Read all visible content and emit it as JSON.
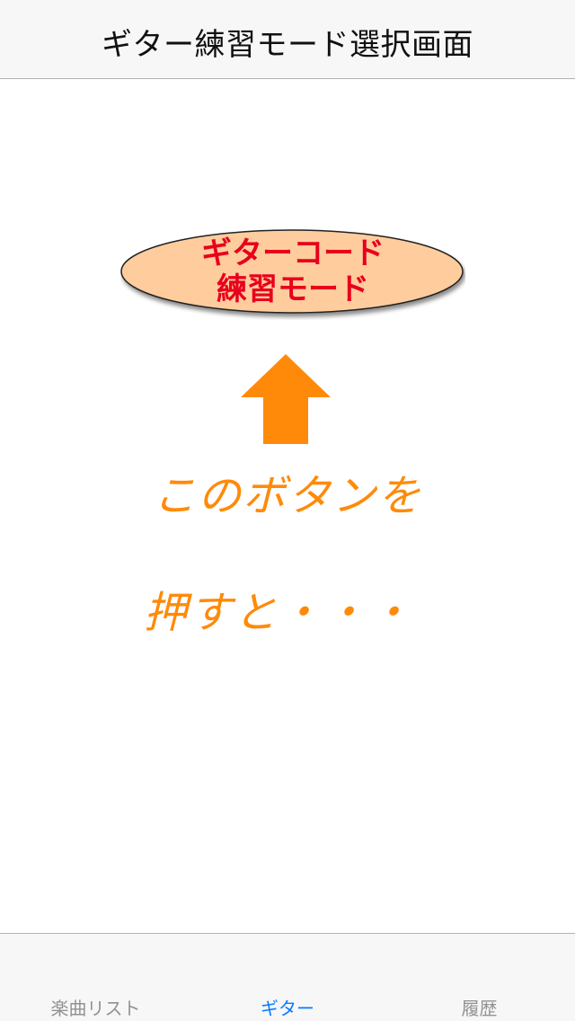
{
  "nav": {
    "title": "ギター練習モード選択画面"
  },
  "main": {
    "mode_button": {
      "line1": "ギターコード",
      "line2": "練習モード"
    },
    "hint": {
      "line1": "このボタンを",
      "line2": "押すと・・・"
    }
  },
  "tabs": [
    {
      "label": "楽曲リスト",
      "selected": false
    },
    {
      "label": "ギター",
      "selected": true
    },
    {
      "label": "履歴",
      "selected": false
    }
  ],
  "colors": {
    "accent": "#0a7aff",
    "tab_inactive": "#929292",
    "button_fill": "#ffcc9e",
    "button_text": "#e8001c",
    "hint_text": "#ff8a0a",
    "arrow": "#ff8a0a"
  },
  "icons": {
    "arrow": "arrow-up-icon"
  }
}
